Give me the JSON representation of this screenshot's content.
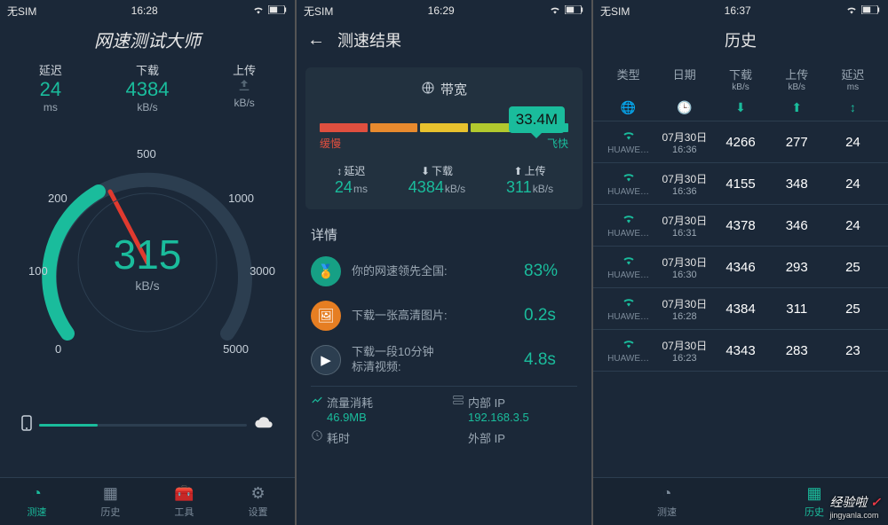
{
  "status": {
    "carrier": "无SIM"
  },
  "screen1": {
    "time": "16:28",
    "title": "网速测试大师",
    "latency_label": "延迟",
    "latency_val": "24",
    "latency_unit": "ms",
    "download_label": "下载",
    "download_val": "4384",
    "download_unit": "kB/s",
    "upload_label": "上传",
    "upload_val": "",
    "upload_unit": "kB/s",
    "gauge_val": "315",
    "gauge_unit": "kB/s",
    "ticks": {
      "t0": "0",
      "t100": "100",
      "t200": "200",
      "t500": "500",
      "t1000": "1000",
      "t3000": "3000",
      "t5000": "5000"
    },
    "tabs": {
      "speed": "测速",
      "history": "历史",
      "tools": "工具",
      "settings": "设置"
    }
  },
  "screen2": {
    "time": "16:29",
    "title": "测速结果",
    "bandwidth_label": "带宽",
    "badge": "33.4M",
    "slow": "缓慢",
    "fast": "飞快",
    "metrics": {
      "latency_lbl": "延迟",
      "latency_val": "24",
      "latency_unit": "ms",
      "dl_lbl": "下载",
      "dl_val": "4384",
      "dl_unit": "kB/s",
      "ul_lbl": "上传",
      "ul_val": "311",
      "ul_unit": "kB/s"
    },
    "details_title": "详情",
    "details": [
      {
        "text": "你的网速领先全国:",
        "val": "83%"
      },
      {
        "text": "下载一张高清图片:",
        "val": "0.2s"
      },
      {
        "text": "下载一段10分钟\n标清视频:",
        "val": "4.8s"
      }
    ],
    "traffic_lbl": "流量消耗",
    "traffic_val": "46.9MB",
    "ip_in_lbl": "内部 IP",
    "ip_in_val": "192.168.3.5",
    "time_cost_lbl": "耗时",
    "ip_out_lbl": "外部 IP"
  },
  "screen3": {
    "time": "16:37",
    "title": "历史",
    "head": {
      "type": "类型",
      "date": "日期",
      "dl": "下载",
      "dl_u": "kB/s",
      "ul": "上传",
      "ul_u": "kB/s",
      "lat": "延迟",
      "lat_u": "ms"
    },
    "rows": [
      {
        "ssid": "HUAWE…",
        "date": "07月30日",
        "time": "16:36",
        "dl": "4266",
        "ul": "277",
        "lat": "24"
      },
      {
        "ssid": "HUAWE…",
        "date": "07月30日",
        "time": "16:36",
        "dl": "4155",
        "ul": "348",
        "lat": "24"
      },
      {
        "ssid": "HUAWE…",
        "date": "07月30日",
        "time": "16:31",
        "dl": "4378",
        "ul": "346",
        "lat": "24"
      },
      {
        "ssid": "HUAWE…",
        "date": "07月30日",
        "time": "16:30",
        "dl": "4346",
        "ul": "293",
        "lat": "25"
      },
      {
        "ssid": "HUAWE…",
        "date": "07月30日",
        "time": "16:28",
        "dl": "4384",
        "ul": "311",
        "lat": "25"
      },
      {
        "ssid": "HUAWE…",
        "date": "07月30日",
        "time": "16:23",
        "dl": "4343",
        "ul": "283",
        "lat": "23"
      }
    ],
    "tabs": {
      "speed": "测速",
      "history": "历史"
    }
  },
  "watermark": {
    "brand": "经验啦",
    "check": "✓",
    "sub": "jingyanla.com"
  },
  "colors": {
    "teal": "#1abc9c",
    "red": "#e04f3f",
    "orange": "#e88a2e",
    "yellow": "#e8c22e",
    "ygreen": "#b2c92e",
    "green": "#1abc9c"
  }
}
